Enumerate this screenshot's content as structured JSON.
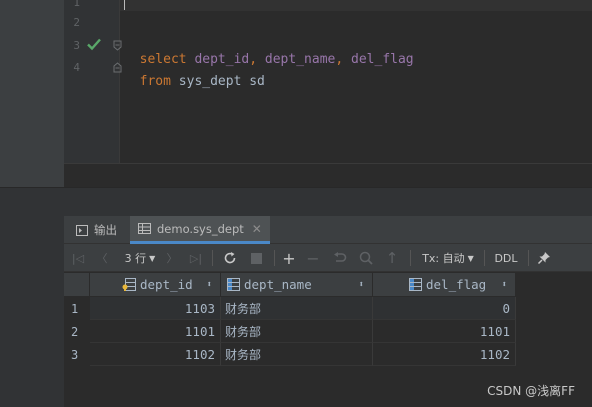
{
  "editor": {
    "line_numbers": [
      "1",
      "2",
      "3",
      "4"
    ],
    "line3": {
      "kw": "select",
      "f1": "dept_id",
      "sep1": ", ",
      "f2": "dept_name",
      "sep2": ", ",
      "f3": "del_flag"
    },
    "line4": {
      "kw": "from",
      "rest": " sys_dept sd"
    },
    "status_icon": "check-icon"
  },
  "tabs": [
    {
      "label": "输出",
      "icon": "output-icon"
    },
    {
      "label": "demo.sys_dept",
      "icon": "table-icon",
      "close": "✕"
    }
  ],
  "toolbar": {
    "first": "|◁",
    "prev": "〈",
    "rows_label": "3 行",
    "next": "〉",
    "last": "▷|",
    "refresh_icon": "refresh-icon",
    "stop_icon": "stop-icon",
    "add": "+",
    "remove": "−",
    "revert_icon": "revert-icon",
    "preview_icon": "preview-icon",
    "submit": "↑",
    "tx_label": "Tx: 自动",
    "ddl_label": "DDL",
    "pin_icon": "pin-icon"
  },
  "grid": {
    "columns": [
      {
        "name": "dept_id",
        "icon": "key-column-icon",
        "sort": "⬍"
      },
      {
        "name": "dept_name",
        "icon": "column-icon",
        "sort": "⬍"
      },
      {
        "name": "del_flag",
        "icon": "column-icon",
        "sort": "⬍"
      }
    ],
    "rows": [
      {
        "num": "1",
        "dept_id": "1103",
        "dept_name": "财务部",
        "del_flag": "0"
      },
      {
        "num": "2",
        "dept_id": "1101",
        "dept_name": "财务部",
        "del_flag": "1101"
      },
      {
        "num": "3",
        "dept_id": "1102",
        "dept_name": "财务部",
        "del_flag": "1102"
      }
    ]
  },
  "watermark": "CSDN @浅离FF"
}
